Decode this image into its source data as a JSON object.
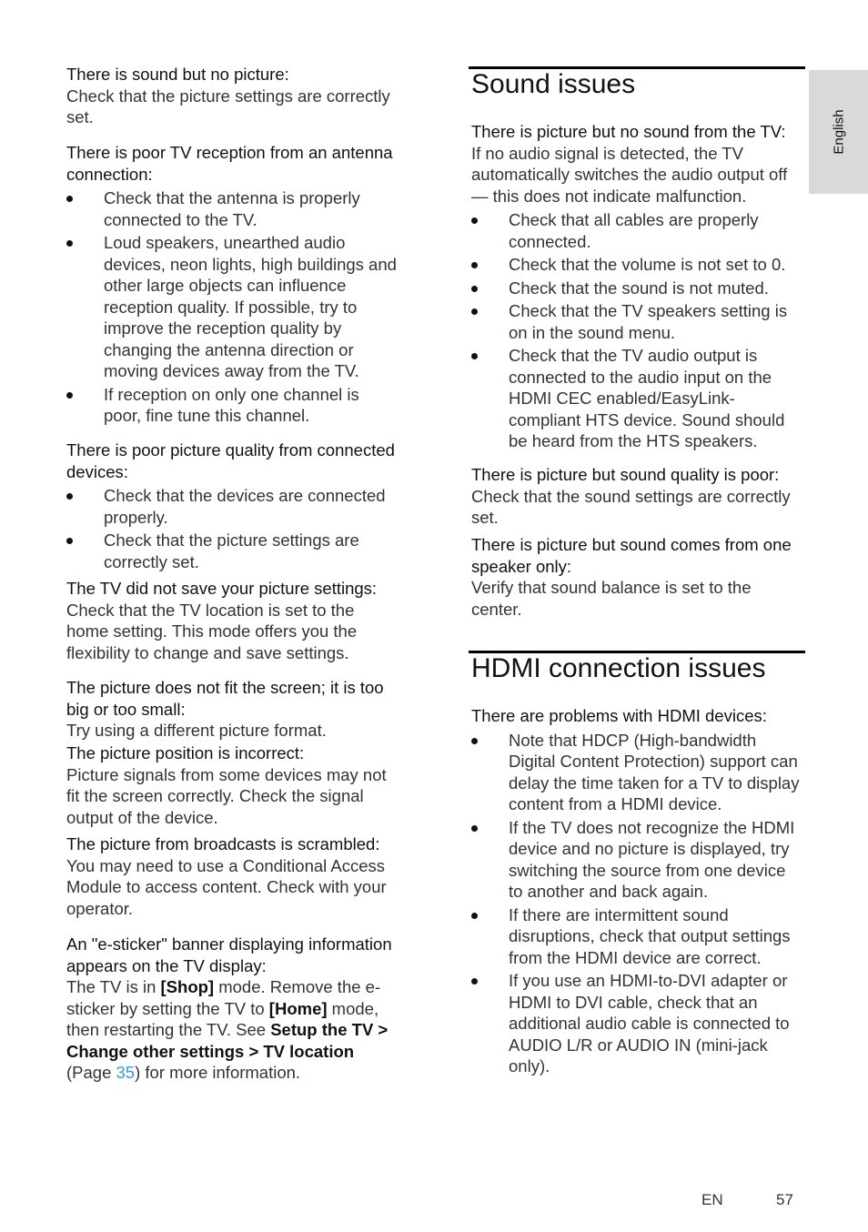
{
  "side_tab": {
    "language": "English"
  },
  "left_column": {
    "sound_no_picture": {
      "heading": "There is sound but no picture:",
      "text": "Check that the picture settings are correctly set."
    },
    "poor_reception": {
      "heading": "There is poor TV reception from an antenna connection:",
      "bullets": [
        "Check that the antenna is properly connected to the TV.",
        "Loud speakers, unearthed audio devices, neon lights, high buildings and other large objects can influence reception quality. If possible, try to improve the reception quality by changing the antenna direction or moving devices away from the TV.",
        "If reception on only one channel is poor, fine tune this channel."
      ]
    },
    "poor_quality_devices": {
      "heading": "There is poor picture quality from connected devices:",
      "bullets": [
        "Check that the devices are connected properly.",
        "Check that the picture settings are correctly set."
      ]
    },
    "not_saved": {
      "heading": "The TV did not save your picture settings:",
      "text": "Check that the TV location is set to the home setting. This mode offers you the flexibility to change and save settings."
    },
    "not_fit": {
      "heading": "The picture does not fit the screen; it is too big or too small:",
      "text": "Try using a different picture format."
    },
    "position": {
      "heading": "The picture position is incorrect:",
      "text": "Picture signals from some devices may not fit the screen correctly. Check the signal output of the device."
    },
    "scrambled": {
      "heading": "The picture from broadcasts is scrambled:",
      "text": "You may need to use a Conditional Access Module to access content. Check with your operator."
    },
    "esticker": {
      "heading": "An \"e-sticker\" banner displaying information appears on the TV display:",
      "text_1": "The TV is in ",
      "shop": "[Shop]",
      "text_2": " mode. Remove the e-sticker by setting the TV to ",
      "home": "[Home]",
      "text_3": " mode, then restarting the TV. See ",
      "path": "Setup the TV > Change other settings > TV location",
      "text_4": " (Page ",
      "page_link": "35",
      "text_5": ") for more information."
    }
  },
  "right_column": {
    "sound_section": {
      "title": "Sound issues",
      "no_sound": {
        "heading": "There is picture but no sound from the TV:",
        "text": "If no audio signal is detected, the TV automatically switches the audio output off — this does not indicate malfunction.",
        "bullets": [
          "Check that all cables are properly connected.",
          "Check that the volume is not set to 0.",
          "Check that the sound is not muted.",
          "Check that the TV speakers setting is on in the sound menu.",
          "Check that the TV audio output is connected to the audio input on the HDMI CEC enabled/EasyLink-compliant HTS device. Sound should be heard from the HTS speakers."
        ]
      },
      "poor_quality": {
        "heading": "There is picture but sound quality is poor:",
        "text": "Check that the sound settings are correctly set."
      },
      "one_speaker": {
        "heading": "There is picture but sound comes from one speaker only:",
        "text": "Verify that sound balance is set to the center."
      }
    },
    "hdmi_section": {
      "title": "HDMI connection issues",
      "problems": {
        "heading": "There are problems with HDMI devices:",
        "bullets": [
          "Note that HDCP (High-bandwidth Digital Content Protection) support can delay the time taken for a TV to display content from a HDMI device.",
          "If the TV does not recognize the HDMI device and no picture is displayed, try switching the source from one device to another and back again.",
          "If there are intermittent sound disruptions, check that output settings from the HDMI device are correct.",
          "If you use an HDMI-to-DVI adapter or HDMI to DVI cable, check that an additional audio cable is connected to AUDIO L/R or AUDIO IN (mini-jack only)."
        ]
      }
    }
  },
  "footer": {
    "language_code": "EN",
    "page_number": "57"
  },
  "colors": {
    "link": "#2a9fd6",
    "side_tab_bg": "#d9d9d9",
    "rule": "#000000"
  }
}
